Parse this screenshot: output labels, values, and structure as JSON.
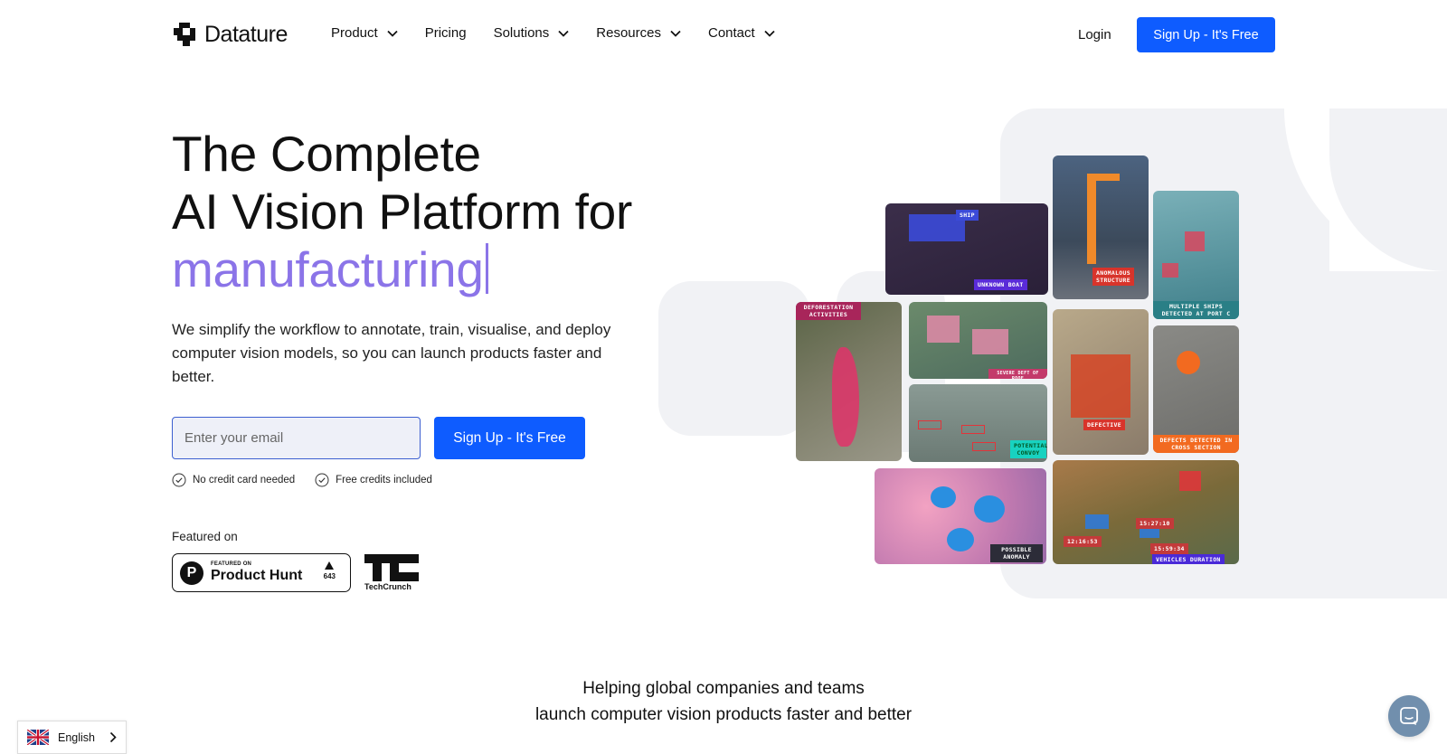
{
  "brand": {
    "name": "Datature"
  },
  "nav": {
    "items": [
      {
        "label": "Product",
        "dropdown": true
      },
      {
        "label": "Pricing",
        "dropdown": false
      },
      {
        "label": "Solutions",
        "dropdown": true
      },
      {
        "label": "Resources",
        "dropdown": true
      },
      {
        "label": "Contact",
        "dropdown": true
      }
    ],
    "login": "Login",
    "signup": "Sign Up - It's Free"
  },
  "hero": {
    "title_line1": "The Complete",
    "title_line2": "AI Vision Platform for",
    "title_accent": "manufacturing",
    "description": "We simplify the workflow to annotate, train, visualise, and deploy computer vision models, so you can launch products faster and better.",
    "email_placeholder": "Enter your email",
    "signup": "Sign Up - It's Free",
    "perks": [
      "No credit card needed",
      "Free credits included"
    ]
  },
  "featured": {
    "label": "Featured on",
    "product_hunt": {
      "small": "FEATURED ON",
      "name": "Product Hunt",
      "votes": "643"
    },
    "techcrunch": "TechCrunch"
  },
  "collage_labels": {
    "ship": "SHIP",
    "unknown_boat": "UNKNOWN BOAT",
    "anomalous_structure": "ANOMALOUS STRUCTURE",
    "multiple_ships": "MULTIPLE SHIPS DETECTED AT PORT C",
    "deforestation": "DEFORESTATION ACTIVITIES",
    "roof": "SEVERE DEFT OF ROOF",
    "defective": "DEFECTIVE",
    "defects_cross": "DEFECTS DETECTED IN CROSS SECTION",
    "convoy": "POTENTIAL CONVOY",
    "anomaly": "POSSIBLE ANOMALY",
    "vehicles_duration": "VEHICLES DURATION",
    "time1": "15:27:10",
    "time2": "12:16:53",
    "time3": "15:59:34"
  },
  "helping": {
    "line1": "Helping global companies and teams",
    "line2": "launch computer vision products faster and better"
  },
  "language": {
    "label": "English"
  },
  "colors": {
    "accent_purple": "#8b74e8",
    "primary_blue": "#0e5cff",
    "shape_gray": "#f1f2f5"
  },
  "icons": [
    "datature-logo-icon",
    "chevron-down-icon",
    "check-circle-icon",
    "uk-flag-icon",
    "chevron-right-icon",
    "chat-icon"
  ]
}
